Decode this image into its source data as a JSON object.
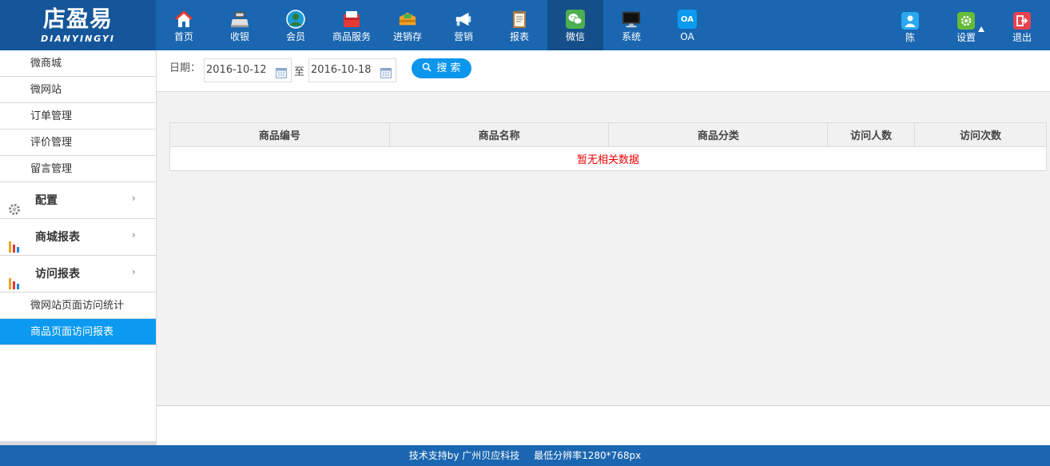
{
  "logo": {
    "cn": "店盈易",
    "en": "DIANYINGYI"
  },
  "nav": [
    {
      "label": "首页",
      "icon": "home-icon"
    },
    {
      "label": "收银",
      "icon": "cash-register-icon"
    },
    {
      "label": "会员",
      "icon": "member-icon"
    },
    {
      "label": "商品服务",
      "icon": "product-service-icon"
    },
    {
      "label": "进销存",
      "icon": "inventory-icon"
    },
    {
      "label": "营销",
      "icon": "megaphone-icon"
    },
    {
      "label": "报表",
      "icon": "report-icon"
    },
    {
      "label": "微信",
      "icon": "wechat-icon"
    },
    {
      "label": "系统",
      "icon": "monitor-icon"
    },
    {
      "label": "OA",
      "icon": "oa-icon",
      "icon_text": "OA"
    }
  ],
  "right_nav": {
    "user": {
      "label": "陈",
      "icon": "user-icon"
    },
    "settings": {
      "label": "设置",
      "icon": "gear-icon"
    },
    "logout": {
      "label": "退出",
      "icon": "logout-icon"
    }
  },
  "sidebar": {
    "items_top": [
      "微商城",
      "微网站",
      "订单管理",
      "评价管理",
      "留言管理"
    ],
    "groups": [
      {
        "label": "配置",
        "icon": "gear-icon"
      },
      {
        "label": "商城报表",
        "icon": "bar-chart-icon"
      },
      {
        "label": "访问报表",
        "icon": "bar-chart-icon"
      }
    ],
    "items_bottom": [
      "微网站页面访问统计",
      "商品页面访问报表"
    ],
    "active": "商品页面访问报表"
  },
  "filter": {
    "date_label": "日期：",
    "start_date": "2016-10-12",
    "to_label": "至",
    "end_date": "2016-10-18",
    "search_label": "搜 索"
  },
  "table": {
    "columns": [
      "商品编号",
      "商品名称",
      "商品分类",
      "访问人数",
      "访问次数"
    ],
    "empty_text": "暂无相关数据"
  },
  "footer": {
    "support": "技术支持by 广州贝应科技",
    "resolution": "最低分辨率1280*768px"
  },
  "colors": {
    "header_bg": "#1a66b0",
    "logo_bg": "#15569a",
    "active_sidebar": "#0b9aef",
    "search_button": "#0b96ec",
    "empty_text": "#e00000"
  }
}
